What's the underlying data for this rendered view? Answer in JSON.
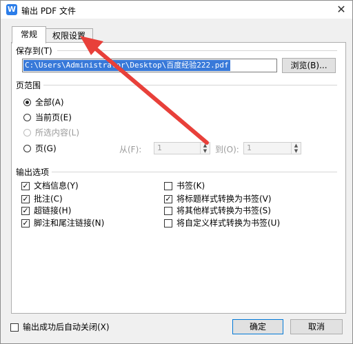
{
  "window": {
    "title": "输出 PDF 文件",
    "app_icon_glyph": "W",
    "close_glyph": "✕"
  },
  "tabs": [
    {
      "label": "常规",
      "active": true
    },
    {
      "label": "权限设置",
      "active": false
    }
  ],
  "save_to": {
    "label": "保存到(T)",
    "path": "C:\\Users\\Administrator\\Desktop\\百度经验222.pdf",
    "browse_label": "浏览(B)..."
  },
  "page_range": {
    "label": "页范围",
    "options": [
      {
        "label": "全部(A)",
        "checked": true,
        "disabled": false
      },
      {
        "label": "当前页(E)",
        "checked": false,
        "disabled": false
      },
      {
        "label": "所选内容(L)",
        "checked": false,
        "disabled": true
      },
      {
        "label": "页(G)",
        "checked": false,
        "disabled": false
      }
    ],
    "from_label": "从(F):",
    "from_value": "1",
    "to_label": "到(O):",
    "to_value": "1"
  },
  "output_options": {
    "label": "输出选项",
    "left": [
      {
        "label": "文档信息(Y)",
        "checked": true
      },
      {
        "label": "批注(C)",
        "checked": true
      },
      {
        "label": "超链接(H)",
        "checked": true
      },
      {
        "label": "脚注和尾注链接(N)",
        "checked": true
      }
    ],
    "right": [
      {
        "label": "书签(K)",
        "checked": false
      },
      {
        "label": "将标题样式转换为书签(V)",
        "checked": true
      },
      {
        "label": "将其他样式转换为书签(S)",
        "checked": false
      },
      {
        "label": "将自定义样式转换为书签(U)",
        "checked": false
      }
    ]
  },
  "footer": {
    "auto_close_label": "输出成功后自动关闭(X)",
    "auto_close_checked": false,
    "ok_label": "确定",
    "cancel_label": "取消"
  },
  "annotation": {
    "arrow_color": "#e8403a"
  }
}
